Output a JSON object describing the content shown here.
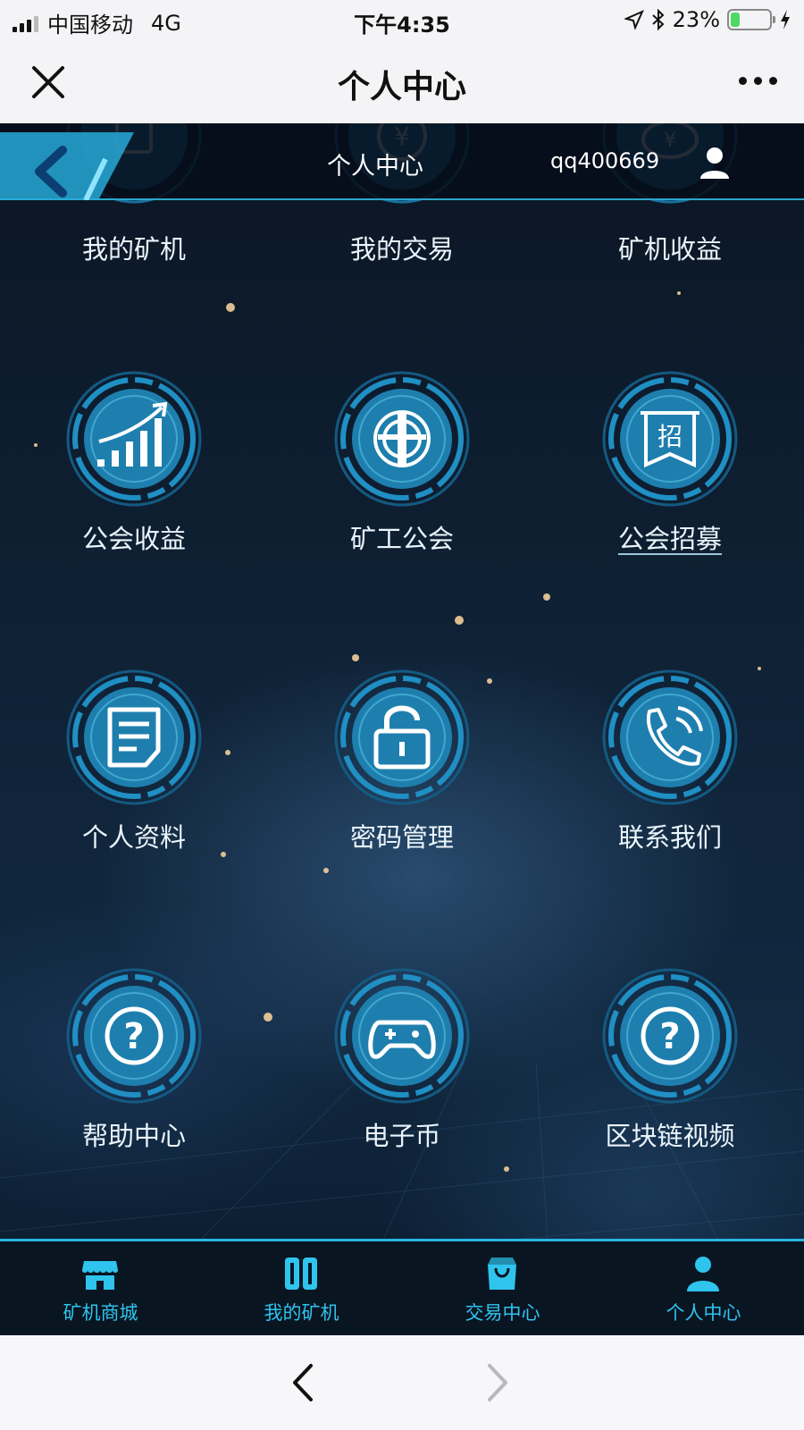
{
  "status_bar": {
    "carrier": "中国移动",
    "network": "4G",
    "time": "下午4:35",
    "battery": "23%",
    "battery_level": 0.23
  },
  "navbar": {
    "title": "个人中心",
    "close_icon": "close-icon",
    "more_icon": "more-icon"
  },
  "header": {
    "title": "个人中心",
    "username": "qq400669",
    "back_icon": "back-arrow-icon",
    "user_icon": "user-icon"
  },
  "top_row": [
    {
      "label": "我的矿机",
      "icon": "tablet-icon"
    },
    {
      "label": "我的交易",
      "icon": "yen-coin-icon"
    },
    {
      "label": "矿机收益",
      "icon": "yen-earnings-icon"
    }
  ],
  "grid": [
    {
      "label": "公会收益",
      "icon": "growth-chart-icon"
    },
    {
      "label": "矿工公会",
      "icon": "union-emblem-icon"
    },
    {
      "label": "公会招募",
      "icon": "recruit-banner-icon",
      "glyph": "招"
    },
    {
      "label": "个人资料",
      "icon": "document-icon"
    },
    {
      "label": "密码管理",
      "icon": "lock-icon"
    },
    {
      "label": "联系我们",
      "icon": "phone-icon"
    },
    {
      "label": "帮助中心",
      "icon": "question-icon",
      "glyph": "?"
    },
    {
      "label": "电子币",
      "icon": "gamepad-icon"
    },
    {
      "label": "区块链视频",
      "icon": "question-icon",
      "glyph": "?"
    }
  ],
  "tabbar": [
    {
      "label": "矿机商城",
      "icon": "store-icon"
    },
    {
      "label": "我的矿机",
      "icon": "machine-icon"
    },
    {
      "label": "交易中心",
      "icon": "shopping-bag-icon"
    },
    {
      "label": "个人中心",
      "icon": "person-icon"
    }
  ],
  "colors": {
    "accent": "#2ec4ee",
    "ring": "#1f8fc4",
    "background": "#0f2236"
  }
}
